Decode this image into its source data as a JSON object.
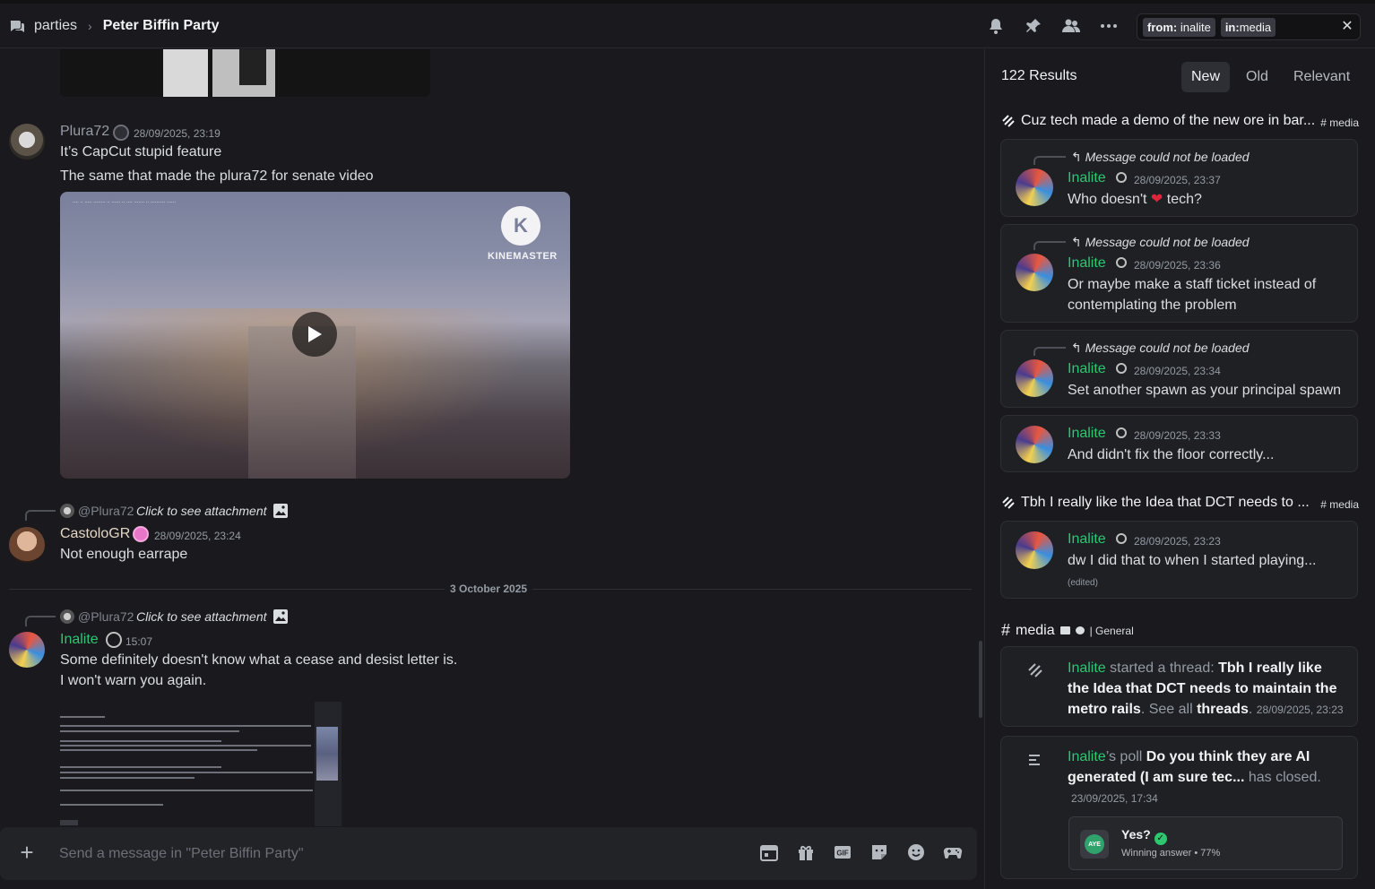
{
  "header": {
    "server": "parties",
    "separator": "›",
    "title": "Peter Biffin Party",
    "search_chips": [
      {
        "key": "from:",
        "value": "inalite"
      },
      {
        "key": "in:",
        "value": "media"
      }
    ]
  },
  "chat": {
    "messages": [
      {
        "author": "Plura72",
        "time": "28/09/2025, 23:19",
        "lines": [
          "It’s CapCut stupid feature",
          "The same that made the plura72 for senate video"
        ]
      },
      {
        "reply_user": "@Plura72",
        "reply_text": "Click to see attachment",
        "author": "CastoloGR",
        "time": "28/09/2025, 23:24",
        "lines": [
          "Not enough earrape"
        ]
      },
      {
        "reply_user": "@Plura72",
        "reply_text": "Click to see attachment",
        "author": "Inalite",
        "time": "15:07",
        "lines": [
          "Some definitely doesn't know what a cease and desist letter is.",
          "I won't warn you again."
        ]
      }
    ],
    "video": {
      "brand_letter": "K",
      "brand": "KINEMASTER"
    },
    "date_divider": "3 October 2025",
    "composer_placeholder": "Send a message in \"Peter Biffin Party\""
  },
  "results": {
    "count": "122 Results",
    "sort_tabs": [
      "New",
      "Old",
      "Relevant"
    ],
    "active_sort": "New",
    "groups": [
      {
        "title": "Cuz tech made a demo of the new ore in bar...",
        "channel": "# media",
        "cards": [
          {
            "reply": "Message could not be loaded",
            "author": "Inalite",
            "time": "28/09/2025, 23:37",
            "text_a": "Who doesn't ",
            "heart": "❤",
            "text_b": " tech?"
          },
          {
            "reply": "Message could not be loaded",
            "author": "Inalite",
            "time": "28/09/2025, 23:36",
            "text": "Or maybe make a staff ticket instead of contemplating the problem"
          },
          {
            "reply": "Message could not be loaded",
            "author": "Inalite",
            "time": "28/09/2025, 23:34",
            "text": "Set another spawn as your principal spawn"
          },
          {
            "author": "Inalite",
            "time": "28/09/2025, 23:33",
            "text": "And didn't fix the floor correctly..."
          }
        ]
      },
      {
        "title": "Tbh I really like the Idea that DCT needs to ...",
        "channel": "# media",
        "cards": [
          {
            "author": "Inalite",
            "time": "28/09/2025, 23:23",
            "text": "dw I did that to when I started playing...",
            "edited": "(edited)"
          }
        ]
      }
    ],
    "media_group": {
      "hash": "#",
      "name": "media",
      "folder": "| General",
      "thread_card": {
        "author": "Inalite",
        "started": " started a thread: ",
        "thread_title": "Tbh I really like the Idea that DCT needs to maintain the metro rails",
        "see_all": ". See all ",
        "threads": "threads",
        "period": ".",
        "time": "28/09/2025, 23:23"
      },
      "poll_card": {
        "author": "Inalite",
        "possessive": "’s poll ",
        "question": "Do you think they are AI generated (I am sure tec...",
        "closed": " has closed.",
        "time": "23/09/2025, 17:34",
        "avatar_label": "AYE",
        "answer": "Yes?",
        "winning": "Winning answer • 77%"
      }
    }
  },
  "icons": {
    "header": [
      "bell-icon",
      "pin-icon",
      "members-icon",
      "more-icon"
    ],
    "composer": [
      "calendar-icon",
      "gift-icon",
      "gif-icon",
      "sticker-icon",
      "emoji-icon",
      "controller-icon"
    ]
  },
  "colors": {
    "accent_green": "#2dc770",
    "background": "#1a1a1e",
    "card": "#1f2024"
  }
}
